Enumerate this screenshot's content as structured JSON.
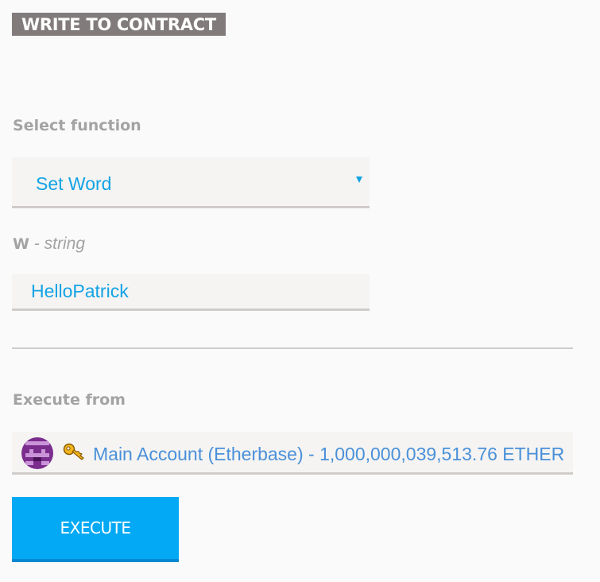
{
  "section": {
    "title": "WRITE TO CONTRACT"
  },
  "function_select": {
    "label": "Select function",
    "selected": "Set Word"
  },
  "parameter": {
    "name": "W",
    "separator": " - ",
    "type": "string",
    "value": "HelloPatrick"
  },
  "execute_from": {
    "label": "Execute from",
    "account_text": "Main Account (Etherbase) - 1,000,000,039,513.76 ETHER"
  },
  "actions": {
    "execute_label": "EXECUTE"
  },
  "colors": {
    "accent": "#03a9f4",
    "value_text": "#12a3e5",
    "account_text": "#4a90d9",
    "label": "#a3a3a3",
    "title_bg": "#827b7b"
  },
  "icons": {
    "account_avatar": "identicon-avatar",
    "key": "key-icon",
    "dropdown": "caret-down-icon"
  }
}
